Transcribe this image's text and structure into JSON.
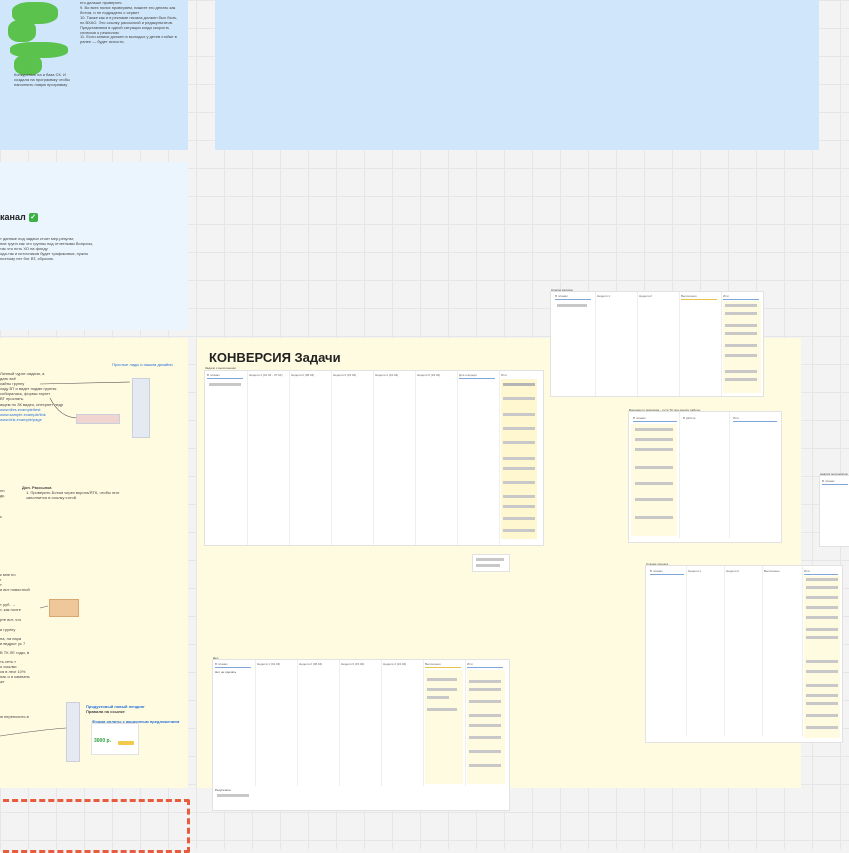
{
  "canvas": {
    "top_left_panel_lines": [
      "его дальше проверять",
      "9. Во всех полях проверяем, нажите его делать как ботом, и не подрядено с сервит",
      "10. Также как и в рекламе начала должен был быть, по ВХАО. Это ссылку рассылкой и редакультатов. Представляем в одной ситуации когда скорость сплюсия о реальном",
      "11. Если записи должен в молодых у детев стойке в ранее — будет ясности."
    ],
    "top_left_footer": [
      "Конкурсные на и база СК. И",
      "создала на программку чтобы",
      "наполнить новую программу"
    ],
    "channel_panel": {
      "title": "канал",
      "check": "✓",
      "lines": [
        "т данные под задачи стоит мер,результ,",
        "ние групп как что группы под отчетными Вопросы,",
        "так что есть ХО на фонду",
        "ода-так и источников будет трафиковых, нужно",
        "поэтому нет бот ВТ, сбросив."
      ]
    },
    "left_yellow_panel": {
      "link_top": "Простые лиды и нашим дизайни",
      "lines_top": [
        "Личный чурит-задачи, а",
        "дать всё",
        "сайты группу",
        "ходу ВТ и видет подаю группы",
        "собиралась, формы таргет",
        "ВТ прослать."
      ],
      "links": [
        "ищем по ЗК видео, интернет ледр",
        "www.tiles.example/test",
        "www.sample.example/link",
        "www.link.example/page"
      ],
      "dop_title": "Доп. Рассылка",
      "dop_lines": [
        "1. Проверить Ботом через ворота/ЯТК, чтобы этот",
        "    заполнится в ссылку сотой"
      ],
      "side_lines": [
        "лп",
        "дь",
        "к"
      ],
      "mid_lines": [
        "к мне по",
        "г",
        "т",
        "и вот новостной",
        "т руб. →",
        "т, как почте",
        "рте вот, что",
        "и группу",
        "на, на пара",
        "и ведрыт ус 7",
        "В ТК ЛЕ годы, в",
        "ть сеть т",
        "о ссылки",
        "ся в лезг 10%",
        "нас и и кампань",
        "жт"
      ],
      "bottom_lines": [
        "ю переносить в"
      ],
      "promo_title": "Продуктовый новый лендинг",
      "promo_sub": "Правила на ссылке",
      "promo_link": "Форма оплаты с акционным предложением",
      "promo_price": "3000 р."
    },
    "conversion_board": {
      "title": "КОНВЕРСИЯ Задачи",
      "subtitle": "Задачи с выполненим",
      "columns": [
        "В планах",
        "Неделя 1 (01.04 - 07.04)",
        "Неделя 2 (08.04)",
        "Неделя 3 (15.04)",
        "Неделя 4 (22.04)",
        "Неделя 5 (29.04)",
        "Для очереди",
        "Итог"
      ],
      "bottom_label": "Дел",
      "bottom_columns": [
        "В планах",
        "Неделя 1 (01.04)",
        "Неделя 2 (08.04)",
        "Неделя 3 (15.04)",
        "Неделя 4 (22.04)",
        "Выполнено",
        "Итог"
      ],
      "bottom_first_row": "Нет не сделать"
    },
    "mini_board_top": {
      "label": "Список запуска",
      "columns": [
        "В планах",
        "Неделя 1",
        "Неделя 2",
        "Выполнено",
        "Итог"
      ]
    },
    "mini_board_mid": {
      "label": "Воронка по запросам – пути ТК лид-сделку работы",
      "columns": [
        "В планах",
        "В работе",
        "Итог"
      ]
    },
    "mini_board_right": {
      "label": "Стадии проекта",
      "columns": [
        "В планах",
        "Неделя 1",
        "Неделя 2",
        "Выполнено",
        "Итог"
      ]
    },
    "far_right_label": "Анализ результатов",
    "far_right_col": "В планах",
    "bottom_left_label": "Результаты"
  }
}
